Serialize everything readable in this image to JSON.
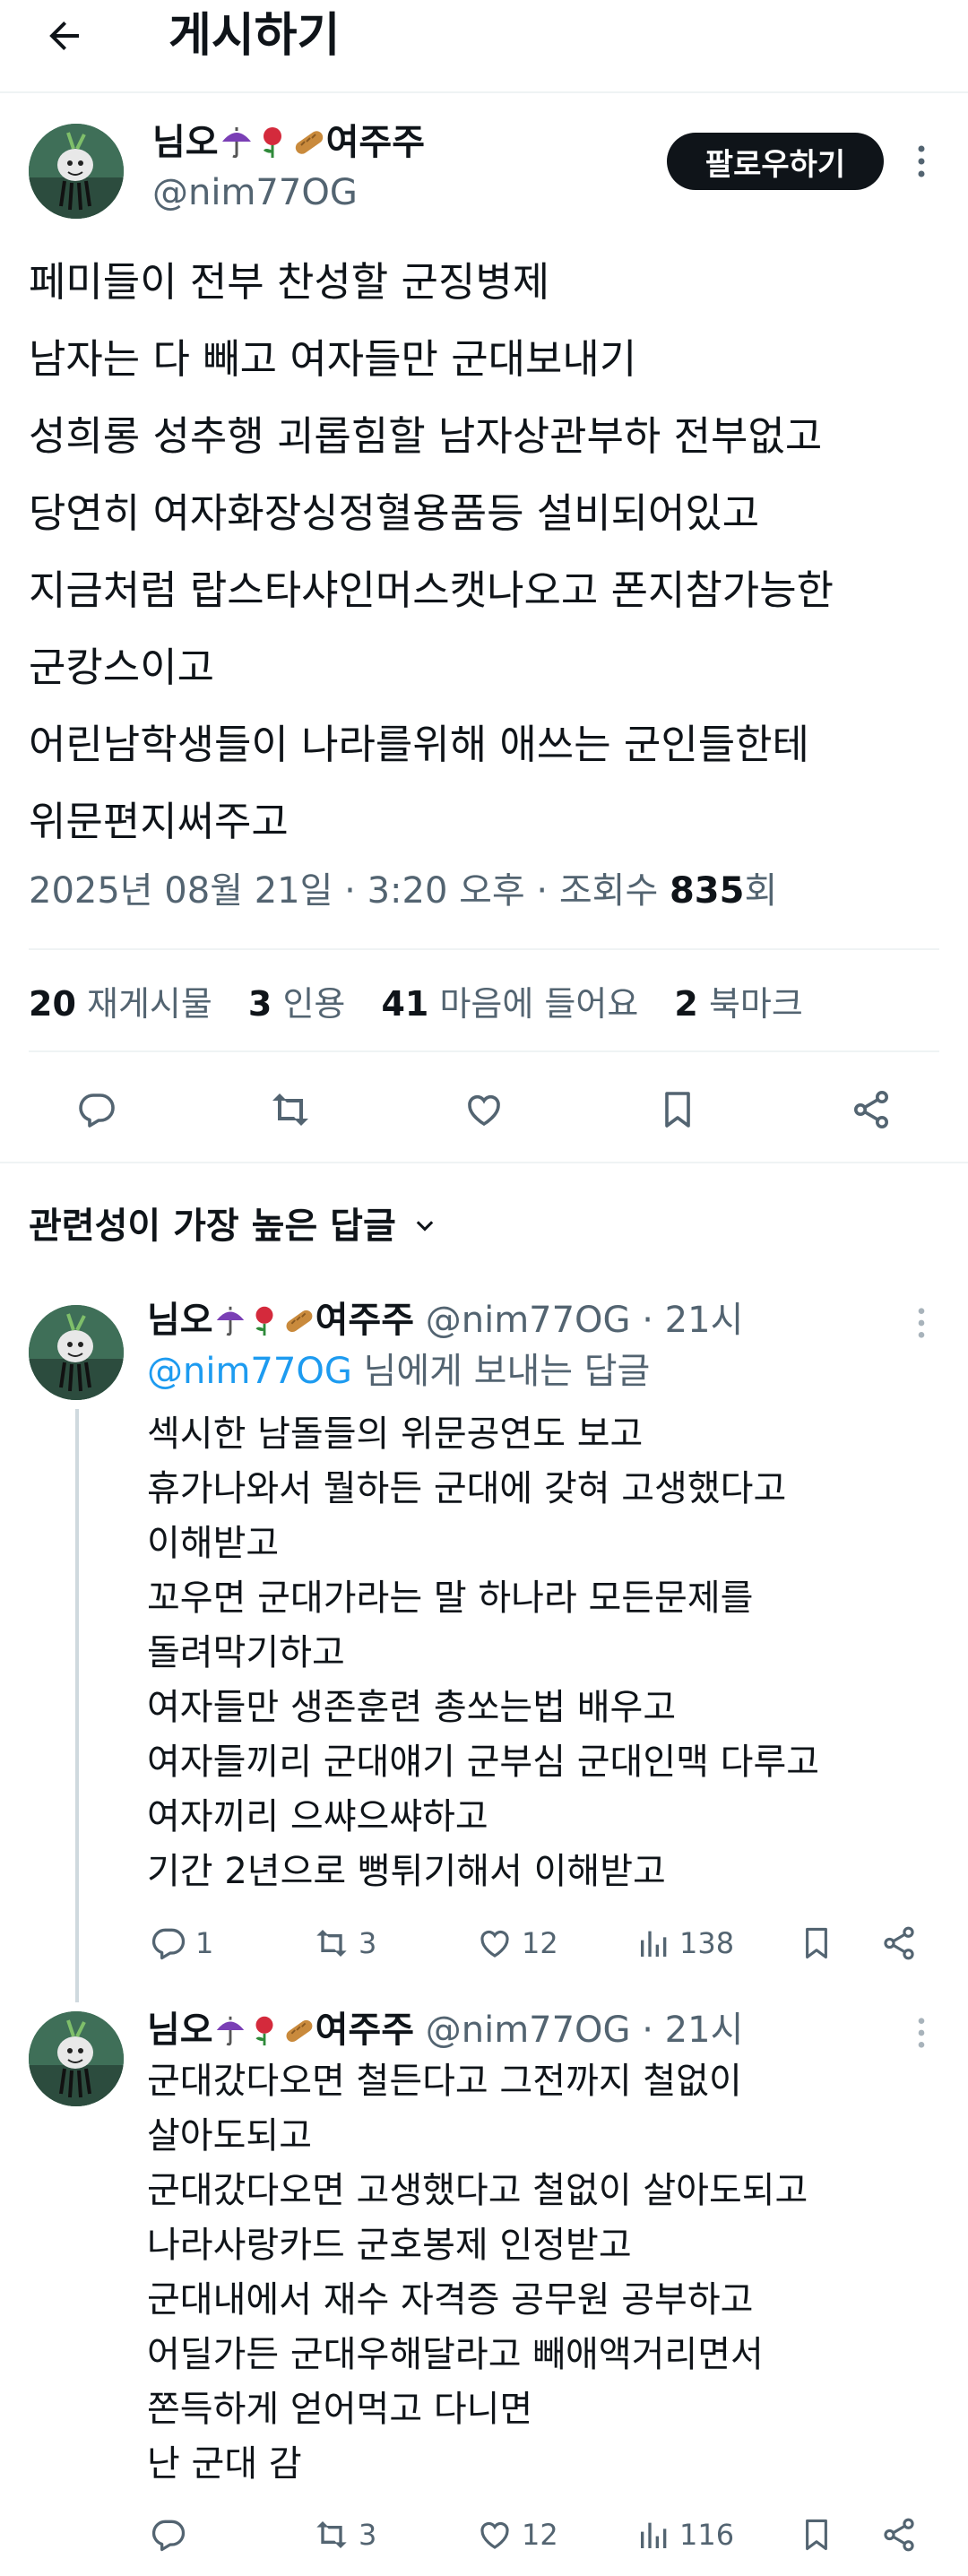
{
  "header": {
    "title": "게시하기"
  },
  "post": {
    "author_name": "님오",
    "author_name_suffix": "여주주",
    "author_emojis": [
      "umbrella-icon",
      "rose-icon",
      "bread-icon"
    ],
    "author_handle": "@nim77OG",
    "follow_label": "팔로우하기",
    "lines": [
      "페미들이 전부 찬성할 군징병제",
      "남자는 다 빼고 여자들만 군대보내기",
      "성희롱 성추행 괴롭힘할 남자상관부하 전부없고",
      "당연히 여자화장싱정혈용품등 설비되어있고",
      "지금처럼 랍스타샤인머스캣나오고 폰지참가능한",
      "군캉스이고",
      "어린남학생들이 나라를위해 애쓰는 군인들한테",
      "위문편지써주고"
    ],
    "timestamp": "2025년 08월 21일 · 3:20 오후 · 조회수 ",
    "views": "835",
    "views_unit": "회",
    "stats": {
      "reposts": "20",
      "reposts_label": "재게시물",
      "quotes": "3",
      "quotes_label": "인용",
      "likes": "41",
      "likes_label": "마음에 들어요",
      "bookmarks": "2",
      "bookmarks_label": "북마크"
    }
  },
  "sort_label": "관련성이 가장 높은 답글",
  "replies": [
    {
      "name": "님오",
      "name_suffix": "여주주",
      "handle_time": " @nim77OG · 21시",
      "reply_to_mention": "@nim77OG",
      "reply_to_text": " 님에게 보내는 답글",
      "lines": [
        "섹시한 남돌들의 위문공연도 보고",
        "휴가나와서 뭘하든 군대에 갖혀 고생했다고",
        "이해받고",
        "꼬우면 군대가라는 말 하나라 모든문제를",
        "돌려막기하고",
        "여자들만 생존훈련 총쏘는법 배우고",
        "여자들끼리 군대얘기 군부심 군대인맥 다루고",
        "여자끼리 으쌰으쌰하고",
        "기간 2년으로 뻥튀기해서 이해받고"
      ],
      "replies_count": "1",
      "reposts_count": "3",
      "likes_count": "12",
      "views_count": "138"
    },
    {
      "name": "님오",
      "name_suffix": "여주주",
      "handle_time": " @nim77OG · 21시",
      "lines": [
        "군대갔다오면 철든다고 그전까지 철없이",
        "살아도되고",
        "군대갔다오면 고생했다고 철없이 살아도되고",
        "나라사랑카드 군호봉제 인정받고",
        "군대내에서 재수 자격증 공무원 공부하고",
        "어딜가든 군대우해달라고 빼애액거리면서",
        "쫀득하게 얻어먹고 다니면",
        "난 군대 감"
      ],
      "replies_count": "",
      "reposts_count": "3",
      "likes_count": "12",
      "views_count": "116"
    }
  ],
  "colors": {
    "text": "#0f1419",
    "secondary": "#536471",
    "accent": "#1d9bf0",
    "border": "#eff3f4"
  }
}
